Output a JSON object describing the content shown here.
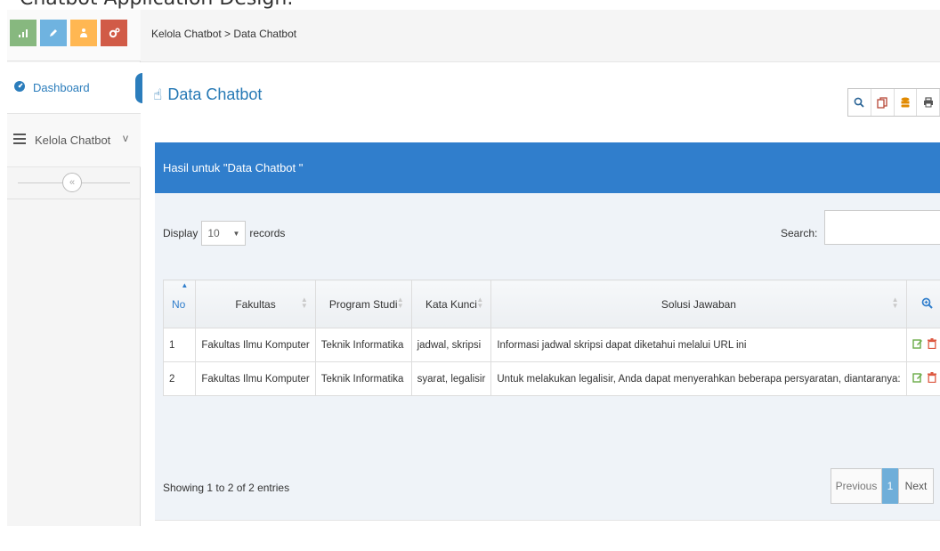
{
  "caption": "Chatbot Application Design.",
  "sidebar": {
    "shortcuts": [
      {
        "icon": "bar-chart-icon",
        "color": "#87b87f"
      },
      {
        "icon": "pencil-icon",
        "color": "#6fb3e0"
      },
      {
        "icon": "users-icon",
        "color": "#ffb752"
      },
      {
        "icon": "cogs-icon",
        "color": "#d15b47"
      }
    ],
    "items": [
      {
        "label": "Dashboard",
        "icon": "dashboard-icon",
        "active": true
      },
      {
        "label": "Kelola Chatbot",
        "icon": "list-icon",
        "chevron": "v"
      }
    ],
    "collapse_icon": "«"
  },
  "breadcrumb": "Kelola Chatbot > Data Chatbot",
  "page": {
    "title": "Data Chatbot",
    "title_icon": "hand-pointer-icon"
  },
  "tools": [
    "search-icon",
    "copy-icon",
    "database-icon",
    "print-icon"
  ],
  "widget": {
    "header": "Hasil untuk \"Data Chatbot \"",
    "display_label": "Display",
    "display_value": "10",
    "records_label": "records",
    "search_label": "Search:",
    "search_value": ""
  },
  "table": {
    "columns": [
      "No",
      "Fakultas",
      "Program Studi",
      "Kata Kunci",
      "Solusi Jawaban"
    ],
    "rows": [
      {
        "no": "1",
        "fakultas": "Fakultas Ilmu Komputer",
        "prodi": "Teknik Informatika",
        "kata_kunci": "jadwal, skripsi",
        "solusi": "Informasi jadwal skripsi dapat diketahui melalui URL ini"
      },
      {
        "no": "2",
        "fakultas": "Fakultas Ilmu Komputer",
        "prodi": "Teknik Informatika",
        "kata_kunci": "syarat, legalisir",
        "solusi": "Untuk melakukan legalisir, Anda dapat menyerahkan beberapa persyaratan, diantaranya:"
      }
    ]
  },
  "footer": {
    "showing": "Showing 1 to 2 of 2 entries",
    "previous": "Previous",
    "page": "1",
    "next": "Next"
  },
  "colors": {
    "accent": "#307ecc",
    "title": "#2679b5"
  }
}
